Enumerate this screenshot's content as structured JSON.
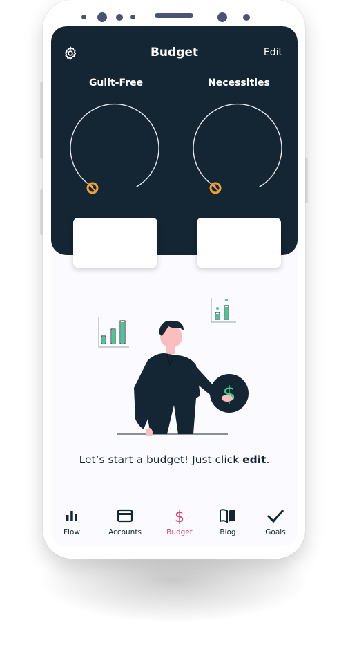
{
  "header": {
    "title": "Budget",
    "edit_label": "Edit",
    "settings_icon": "gear-icon"
  },
  "dials": [
    {
      "label": "Guilt-Free",
      "card_value": ""
    },
    {
      "label": "Necessities",
      "card_value": ""
    }
  ],
  "empty_state": {
    "message_prefix": "Let’s start a budget! Just click ",
    "message_emphasis": "edit",
    "message_suffix": "."
  },
  "tabs": [
    {
      "label": "Flow",
      "icon": "bar-chart-icon",
      "active": false
    },
    {
      "label": "Accounts",
      "icon": "credit-card-icon",
      "active": false
    },
    {
      "label": "Budget",
      "icon": "dollar-icon",
      "active": true
    },
    {
      "label": "Blog",
      "icon": "book-icon",
      "active": false
    },
    {
      "label": "Goals",
      "icon": "checkmark-icon",
      "active": false
    }
  ],
  "colors": {
    "header_bg": "#142533",
    "accent_active": "#e2426e",
    "dial_knob": "#f0a032",
    "chart_green": "#3ecf8e"
  }
}
